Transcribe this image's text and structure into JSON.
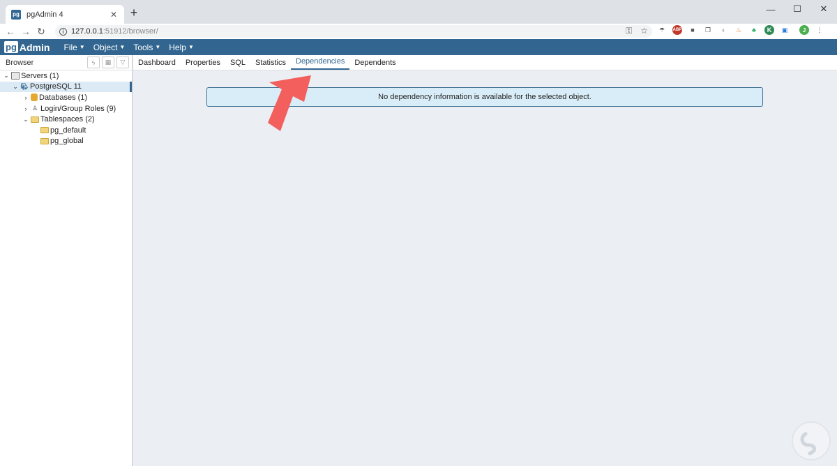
{
  "browser_tab": {
    "title": "pgAdmin 4",
    "favicon": "pg",
    "close": "✕"
  },
  "newtab": "+",
  "window": {
    "minimize": "—",
    "maximize": "☐",
    "close": "✕"
  },
  "address": {
    "host": "127.0.0.1",
    "rest": ":51912/browser/"
  },
  "navbar": {
    "brand_pg": "pg",
    "brand_admin": "Admin",
    "menus": [
      "File",
      "Object",
      "Tools",
      "Help"
    ]
  },
  "extensions": {
    "abp": "ABP",
    "k": "K",
    "avatar": "J"
  },
  "browser_panel": {
    "title": "Browser",
    "tree": [
      {
        "label": "Servers (1)",
        "toggle": "⌄",
        "icon": "server"
      },
      {
        "label": "PostgreSQL 11",
        "toggle": "⌄",
        "icon": "elephant"
      },
      {
        "label": "Databases (1)",
        "toggle": "›",
        "icon": "database"
      },
      {
        "label": "Login/Group Roles (9)",
        "toggle": "›",
        "icon": "role"
      },
      {
        "label": "Tablespaces (2)",
        "toggle": "⌄",
        "icon": "folder"
      },
      {
        "label": "pg_default",
        "toggle": "",
        "icon": "folder"
      },
      {
        "label": "pg_global",
        "toggle": "",
        "icon": "folder"
      }
    ]
  },
  "panel_tabs": [
    "Dashboard",
    "Properties",
    "SQL",
    "Statistics",
    "Dependencies",
    "Dependents"
  ],
  "active_tab": "Dependencies",
  "message": "No dependency information is available for the selected object.",
  "colors": {
    "navbar": "#326690",
    "alert_bg": "#d9edf8",
    "arrow": "#f25f5c"
  }
}
